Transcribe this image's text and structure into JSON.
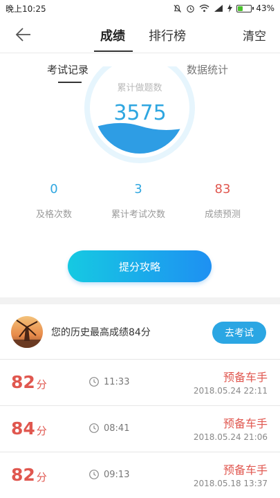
{
  "status_bar": {
    "time": "晚上10:25",
    "battery": "43%",
    "battery_level": 0.43,
    "icons": [
      "mute-icon",
      "alarm-icon",
      "wifi-icon",
      "signal-icon",
      "charging-icon",
      "battery-icon"
    ]
  },
  "header": {
    "tabs": [
      {
        "label": "成绩",
        "active": true
      },
      {
        "label": "排行榜",
        "active": false
      }
    ],
    "clear_label": "清空",
    "back_icon": "back-arrow-icon"
  },
  "sub_tabs": [
    {
      "label": "考试记录",
      "active": true
    },
    {
      "label": "数据统计",
      "active": false
    }
  ],
  "summary": {
    "ring_label": "累计做题数",
    "total_questions": "3575"
  },
  "stats": [
    {
      "value": "0",
      "label": "及格次数",
      "color": "#2ea6e0"
    },
    {
      "value": "3",
      "label": "累计考试次数",
      "color": "#2ea6e0"
    },
    {
      "value": "83",
      "label": "成绩预测",
      "color": "#e0574f"
    }
  ],
  "tip_button_label": "提分攻略",
  "best": {
    "text": "您的历史最高成绩84分",
    "button_label": "去考试"
  },
  "records": [
    {
      "score": "82",
      "unit": "分",
      "time": "11:33",
      "level": "预备车手",
      "date": "2018.05.24  22:11"
    },
    {
      "score": "84",
      "unit": "分",
      "time": "08:41",
      "level": "预备车手",
      "date": "2018.05.24  21:06"
    },
    {
      "score": "82",
      "unit": "分",
      "time": "09:13",
      "level": "预备车手",
      "date": "2018.05.18  13:37"
    }
  ],
  "colors": {
    "accent_blue": "#2ea6e0",
    "score_red": "#e0574f",
    "button_gradient_start": "#16c9e2",
    "button_gradient_end": "#1e90f2"
  }
}
